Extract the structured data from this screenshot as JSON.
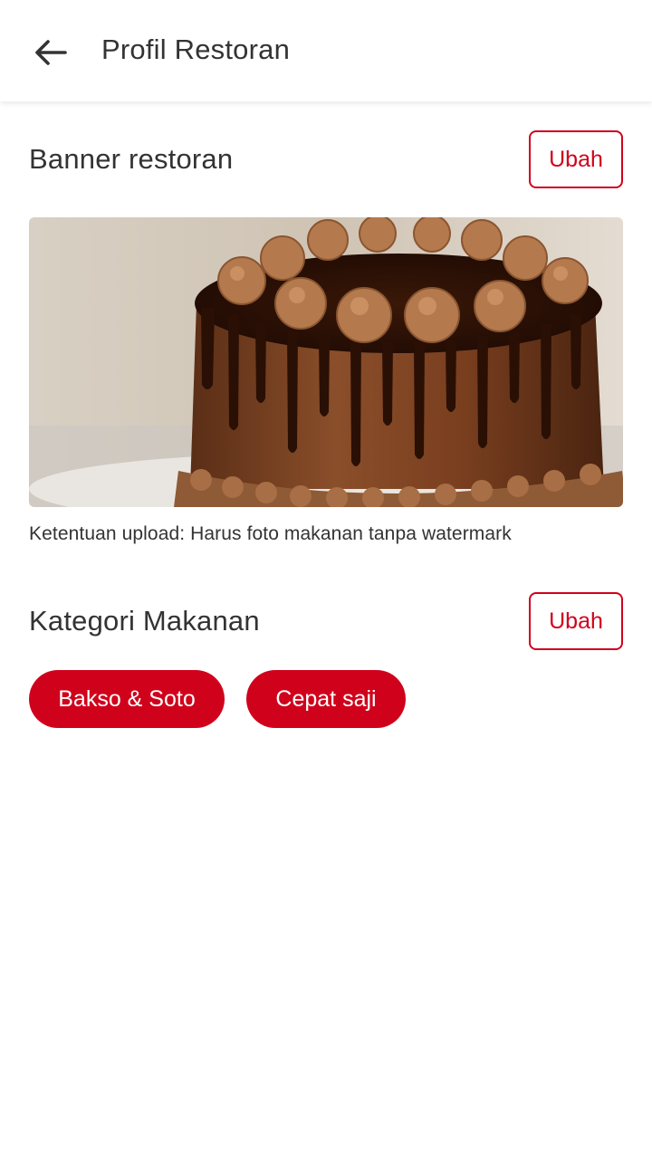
{
  "app_bar": {
    "back_icon": "arrow-left-icon",
    "title": "Profil Restoran"
  },
  "banner_section": {
    "title": "Banner restoran",
    "edit_label": "Ubah",
    "image_icon": "chocolate-cake-photo",
    "upload_note": "Ketentuan upload: Harus foto makanan tanpa watermark"
  },
  "category_section": {
    "title": "Kategori Makanan",
    "edit_label": "Ubah",
    "chips": [
      {
        "label": "Bakso & Soto"
      },
      {
        "label": "Cepat saji"
      }
    ]
  },
  "colors": {
    "accent": "#d0021b",
    "text": "#333333",
    "background": "#ffffff"
  }
}
